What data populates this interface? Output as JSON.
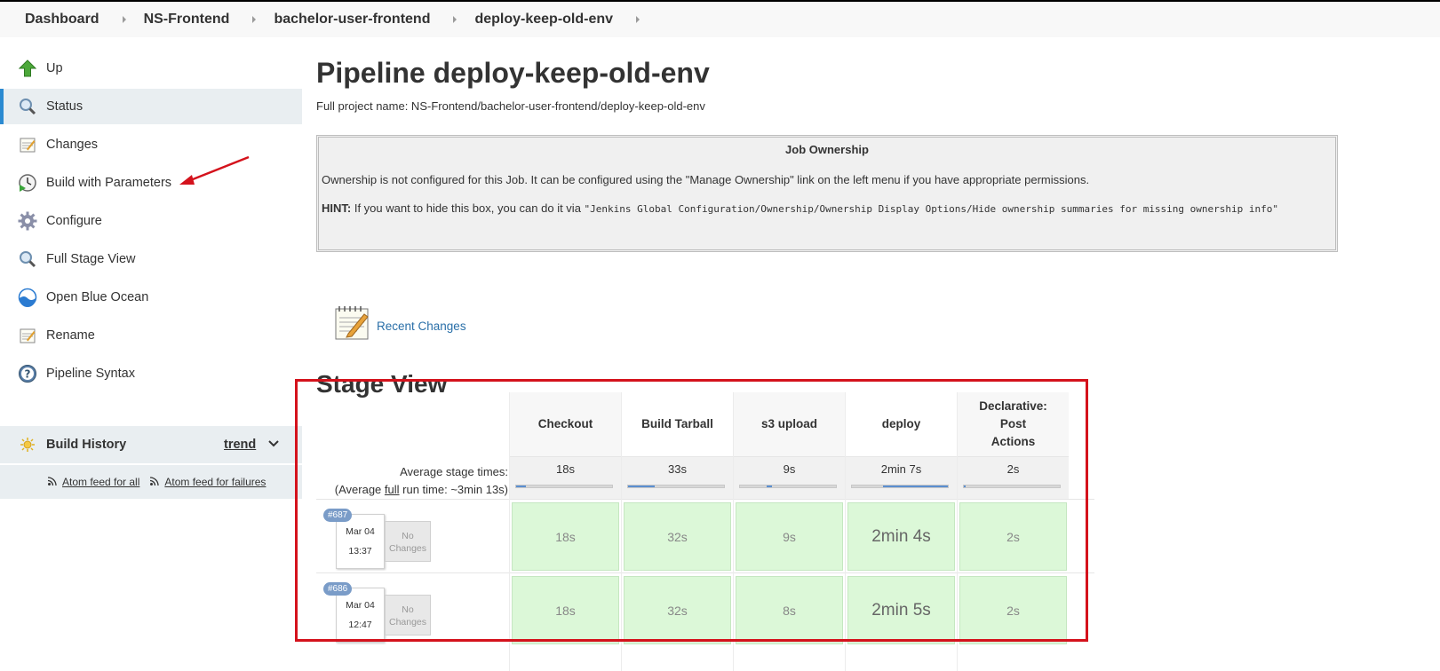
{
  "breadcrumb": [
    "Dashboard",
    "NS-Frontend",
    "bachelor-user-frontend",
    "deploy-keep-old-env"
  ],
  "sidebar": {
    "items": [
      {
        "label": "Up",
        "icon": "arrow-up-icon"
      },
      {
        "label": "Status",
        "icon": "magnifier-icon",
        "active": true
      },
      {
        "label": "Changes",
        "icon": "notepad-icon"
      },
      {
        "label": "Build with Parameters",
        "icon": "clock-play-icon"
      },
      {
        "label": "Configure",
        "icon": "gear-icon"
      },
      {
        "label": "Full Stage View",
        "icon": "magnifier-icon"
      },
      {
        "label": "Open Blue Ocean",
        "icon": "blue-ocean-icon"
      },
      {
        "label": "Rename",
        "icon": "notepad-icon"
      },
      {
        "label": "Pipeline Syntax",
        "icon": "help-icon"
      }
    ],
    "build_history": {
      "label": "Build History",
      "trend": "trend",
      "feed_all": "Atom feed for all",
      "feed_failures": "Atom feed for failures"
    }
  },
  "main": {
    "title": "Pipeline deploy-keep-old-env",
    "full_name": "Full project name: NS-Frontend/bachelor-user-frontend/deploy-keep-old-env",
    "ownership": {
      "title": "Job Ownership",
      "text": "Ownership is not configured for this Job. It can be configured using the \"Manage Ownership\" link on the left menu if you have appropriate permissions.",
      "hint_label": "HINT:",
      "hint_text": " If you want to hide this box, you can do it via ",
      "hint_code": "\"Jenkins Global Configuration/Ownership/Ownership Display Options/Hide ownership summaries for missing ownership info\""
    },
    "recent_changes": "Recent Changes",
    "stage_view": {
      "title": "Stage View",
      "avg_label": "Average stage times:",
      "avg_run_prefix": "(Average ",
      "avg_run_full": "full",
      "avg_run_suffix": " run time: ~3min 13s)",
      "stages": [
        {
          "name": "Checkout",
          "avg": "18s",
          "bar_start": 0,
          "bar_fill": 0.1
        },
        {
          "name": "Build Tarball",
          "avg": "33s",
          "bar_start": 0,
          "bar_fill": 0.28
        },
        {
          "name": "s3 upload",
          "avg": "9s",
          "bar_start": 0.28,
          "bar_fill": 0.05
        },
        {
          "name": "deploy",
          "avg": "2min 7s",
          "bar_start": 0.32,
          "bar_fill": 0.68
        },
        {
          "name": "Declarative: Post Actions",
          "avg": "2s",
          "bar_start": 0,
          "bar_fill": 0.02
        }
      ],
      "builds": [
        {
          "id": "#687",
          "date": "Mar 04",
          "time": "13:37",
          "changes": "No Changes",
          "durations": [
            "18s",
            "32s",
            "9s",
            "2min 4s",
            "2s"
          ]
        },
        {
          "id": "#686",
          "date": "Mar 04",
          "time": "12:47",
          "changes": "No Changes",
          "durations": [
            "18s",
            "32s",
            "8s",
            "2min 5s",
            "2s"
          ]
        }
      ]
    }
  },
  "colors": {
    "highlight_box": "#d4121c",
    "success_cell": "#dcf8d8",
    "active_border": "#2b8ad1",
    "link": "#2a6fa8"
  }
}
